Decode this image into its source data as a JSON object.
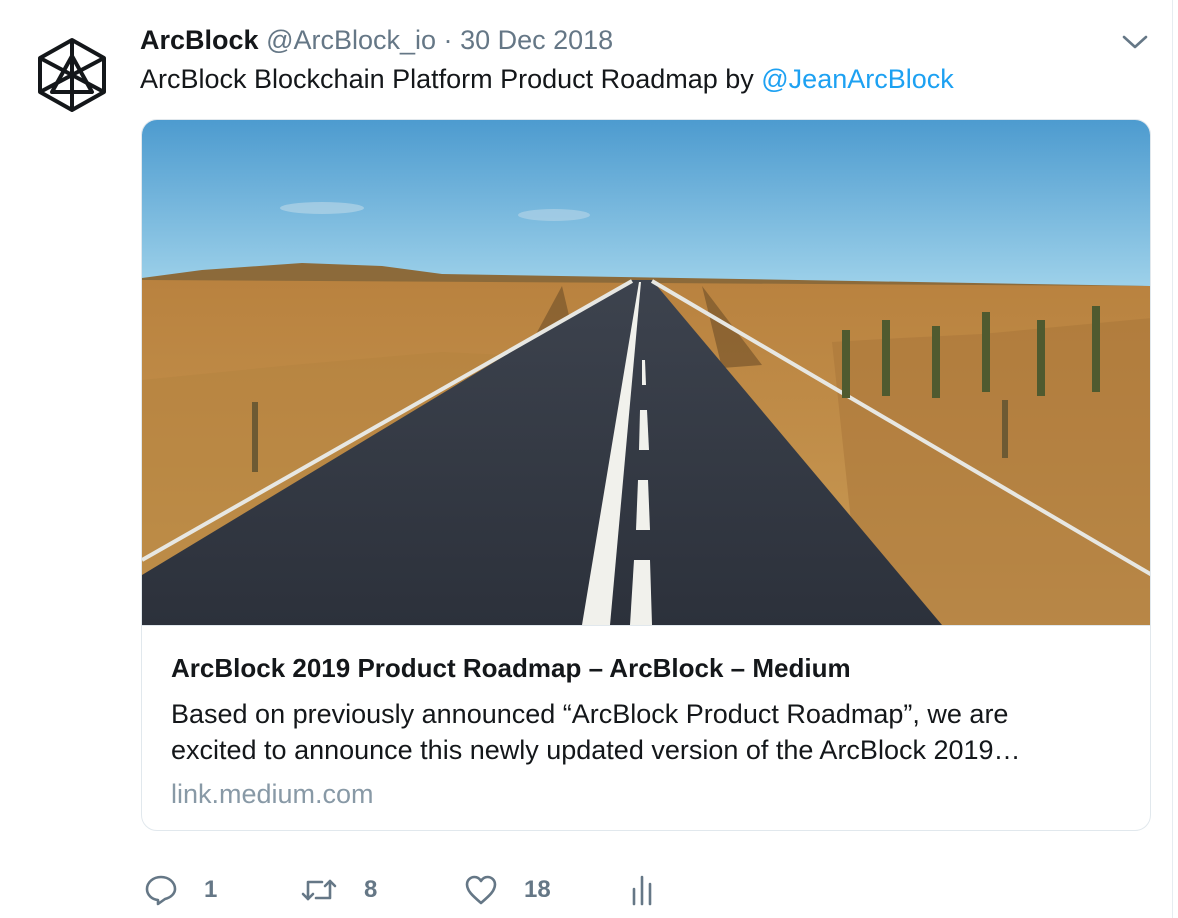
{
  "tweet": {
    "display_name": "ArcBlock",
    "handle": "@ArcBlock_io",
    "separator": "·",
    "date": "30 Dec 2018",
    "text_prefix": "ArcBlock Blockchain Platform Product Roadmap by ",
    "mention": "@JeanArcBlock"
  },
  "card": {
    "title": "ArcBlock 2019 Product Roadmap – ArcBlock – Medium",
    "description": "Based on previously announced “ArcBlock Product Roadmap”, we are excited to announce this newly updated version of the ArcBlock 2019…",
    "domain": "link.medium.com",
    "image_alt": "Straight empty road through golden fields under blue sky"
  },
  "actions": {
    "reply_count": "1",
    "retweet_count": "8",
    "like_count": "18"
  },
  "icons": {
    "avatar": "arcblock-logo-icon",
    "more": "chevron-down-icon",
    "reply": "reply-icon",
    "retweet": "retweet-icon",
    "like": "heart-icon",
    "analytics": "analytics-icon"
  },
  "colors": {
    "text": "#14171a",
    "secondary": "#657786",
    "link": "#1da1f2",
    "muted": "#8899a6",
    "border": "#e1e8ed"
  }
}
